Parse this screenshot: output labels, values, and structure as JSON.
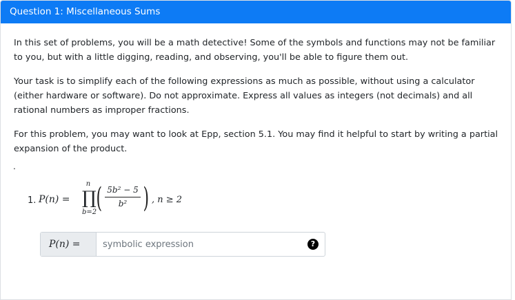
{
  "header": {
    "title": "Question 1: Miscellaneous Sums"
  },
  "paragraphs": [
    "In this set of problems, you will be a math detective! Some of the symbols and functions may not be familiar to you, but with a little digging, reading, and observing, you'll be able to figure them out.",
    "Your task is to simplify each of the following expressions as much as possible, without using a calculator (either hardware or software). Do not approximate. Express all values as integers (not decimals) and all rational numbers as improper fractions.",
    "For this problem, you may want to look at Epp, section 5.1. You may find it helpful to start by writing a partial expansion of the product."
  ],
  "separator": ".",
  "problem": {
    "number": "1.",
    "lhs": "P(n) =",
    "upper_limit": "n",
    "operator": "∏",
    "lower_limit": "b=2",
    "left_paren": "(",
    "right_paren": ")",
    "numerator": "5b² − 5",
    "denominator": "b²",
    "condition": ", n ≥ 2"
  },
  "answer": {
    "label": "P(n) =",
    "placeholder": "symbolic expression",
    "value": "",
    "help_icon": "question-circle-icon",
    "help_glyph": "?"
  },
  "colors": {
    "header_bg": "#0d7bf5",
    "header_text": "#ffffff"
  }
}
